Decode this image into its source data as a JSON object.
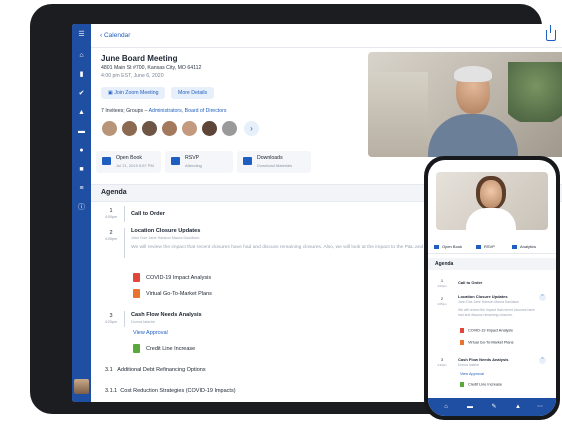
{
  "tablet": {
    "back_label": "Calendar",
    "title": "June Board Meeting",
    "address": "4801 Main St #700, Kansas City, MO 64112",
    "datetime": "4:00 pm EST, June 6, 2020",
    "join_button": "Join Zoom Meeting",
    "details_button": "More Details",
    "invitees_prefix": "7 Invitees; Groups – ",
    "invitees_groups": "Administrators, Board of Directors",
    "more_avatars": "›",
    "actions": [
      {
        "label": "Open Book",
        "sub": "Jul 21, 2019 5:57 PM"
      },
      {
        "label": "RSVP",
        "sub": "Attending"
      },
      {
        "label": "Downloads",
        "sub": "Download Materials"
      }
    ],
    "agenda_title": "Agenda",
    "agenda": {
      "item1": {
        "num": "1",
        "time": "4:00pm",
        "title": "Call to Order"
      },
      "item2": {
        "num": "2",
        "time": "4:05pm",
        "title": "Location Closure Updates",
        "presenter": "John Doe Jane Hanson Maura Davidson",
        "description": "We will review the impact that recent closures have had and discuss remaining closures. Also, we will look at the impact to the P&L and revi these losses."
      },
      "docs2": [
        "COVID-19 Impact Analysis",
        "Virtual Go-To-Market Plans"
      ],
      "item3": {
        "num": "3",
        "time": "4:20pm",
        "title": "Cash Flow Needs Analysis",
        "presenter": "Donna Ialarbe"
      },
      "view_approval": "View Approval",
      "docs3": [
        "Credit Line Increase"
      ],
      "sub31": {
        "num": "3.1",
        "title": "Additional Debt Refinancing Options"
      },
      "sub311": {
        "num": "3.1.1",
        "title": "Cost Reduction Strategies (COVID-19 Impacts)"
      }
    }
  },
  "phone": {
    "actions": [
      "Open Book",
      "RSVP",
      "Analytics"
    ],
    "agenda_title": "Agenda",
    "item1": {
      "num": "1",
      "time": "4:00pm",
      "title": "Call to Order"
    },
    "item2": {
      "num": "2",
      "time": "4:05pm",
      "title": "Location Closure Updates",
      "presenter": "John Doe Jane Hanson Maura Davidson",
      "description": "We will review the impact that recent closures have had and discuss remaining closures."
    },
    "docs2": [
      "COVID-19 Impact Analysis",
      "Virtual Go-To-Market Plans"
    ],
    "item3": {
      "num": "3",
      "time": "4:20pm",
      "title": "Cash Flow Needs Analysis",
      "presenter": "Donna Ialarbe"
    },
    "view_approval": "View Approval",
    "docs3": [
      "Credit Line Increase"
    ]
  },
  "colors": {
    "brand": "#1f4fa3",
    "accent": "#1f5fbf",
    "pdf_red": "#e0473a",
    "pdf_orange": "#e8742f",
    "doc_green": "#5aa83b"
  },
  "icons": {
    "sidebar": [
      "menu-icon",
      "home-icon",
      "tablet-icon",
      "check-icon",
      "alert-icon",
      "folder-icon",
      "person-icon",
      "chat-icon",
      "list-icon",
      "info-icon"
    ],
    "phone_tabs": [
      "home-icon",
      "inbox-icon",
      "edit-icon",
      "alert-icon",
      "more-icon"
    ]
  }
}
